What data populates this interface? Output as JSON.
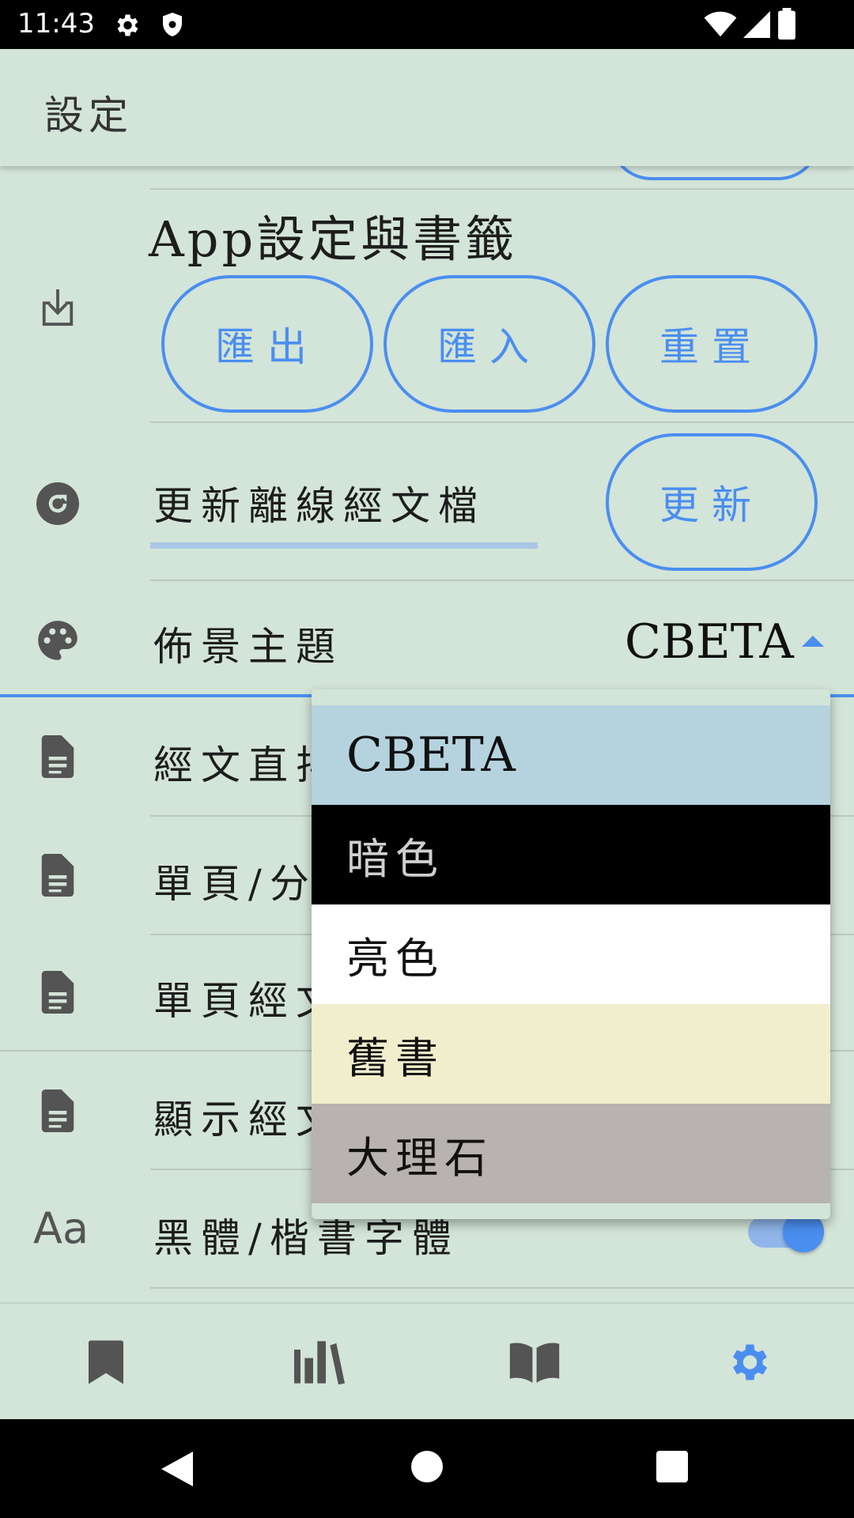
{
  "status_bar": {
    "time": "11:43"
  },
  "header": {
    "title": "設定"
  },
  "backup": {
    "title": "App設定與書籤",
    "export_label": "匯出",
    "import_label": "匯入",
    "reset_label": "重置"
  },
  "offline": {
    "field_value": "更新離線經文檔",
    "update_label": "更新"
  },
  "theme": {
    "label": "佈景主題",
    "selected": "CBETA",
    "options": [
      {
        "label": "CBETA",
        "bg": "#b5d3df",
        "color": "#111111"
      },
      {
        "label": "暗色",
        "bg": "#000000",
        "color": "#cfcfcf"
      },
      {
        "label": "亮色",
        "bg": "#ffffff",
        "color": "#111111"
      },
      {
        "label": "舊書",
        "bg": "#f1eecd",
        "color": "#111111"
      },
      {
        "label": "大理石",
        "bg": "#b8b3b0",
        "color": "#111111"
      }
    ]
  },
  "settings_rows": [
    {
      "label": "經文直排"
    },
    {
      "label": "單頁/分頁"
    },
    {
      "label": "單頁經文"
    },
    {
      "label": "顯示經文"
    },
    {
      "label": "黑體/楷書字體"
    }
  ],
  "colors": {
    "accent": "#4a8ef0",
    "background": "#d3e4d8",
    "icon": "#545454"
  }
}
